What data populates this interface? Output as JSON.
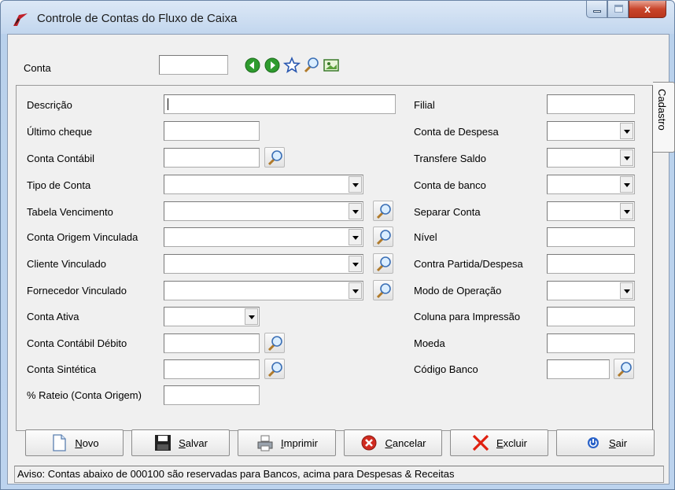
{
  "window": {
    "title": "Controle de Contas do Fluxo de Caixa",
    "close_glyph": "x"
  },
  "top": {
    "conta_label": "Conta",
    "conta_value": ""
  },
  "tab_label": "Cadastro",
  "left_fields": {
    "descricao": "Descrição",
    "ultimo_cheque": "Último cheque",
    "conta_contabil": "Conta Contábil",
    "tipo_conta": "Tipo de Conta",
    "tabela_vencimento": "Tabela Vencimento",
    "conta_origem": "Conta Origem Vinculada",
    "cliente": "Cliente Vinculado",
    "fornecedor": "Fornecedor Vinculado",
    "conta_ativa": "Conta Ativa",
    "contabil_debito": "Conta Contábil Débito",
    "conta_sintetica": "Conta Sintética",
    "rateio": "% Rateio (Conta Origem)"
  },
  "right_fields": {
    "filial": "Filial",
    "conta_despesa": "Conta de Despesa",
    "transfere_saldo": "Transfere Saldo",
    "conta_banco": "Conta de banco",
    "separar_conta": "Separar Conta",
    "nivel": "Nível",
    "contra_partida": "Contra Partida/Despesa",
    "modo_operacao": "Modo de Operação",
    "coluna_impressao": "Coluna para Impressão",
    "moeda": "Moeda",
    "codigo_banco": "Código Banco"
  },
  "buttons": {
    "novo": {
      "key": "N",
      "rest": "ovo"
    },
    "salvar": {
      "key": "S",
      "rest": "alvar"
    },
    "imprimir": {
      "key": "I",
      "rest": "mprimir"
    },
    "cancelar": {
      "key": "C",
      "rest": "ancelar"
    },
    "excluir": {
      "key": "E",
      "rest": "xcluir"
    },
    "sair": {
      "key": "S",
      "rest": "air"
    }
  },
  "status": "Aviso: Contas abaixo de 000100 são reservadas para Bancos, acima para Despesas & Receitas",
  "icons": {
    "app": "app-logo-icon",
    "prev": "previous-record-icon",
    "next": "next-record-icon",
    "favorite": "star-icon",
    "search": "magnifier-icon",
    "image": "picture-icon"
  },
  "colors": {
    "window_frame": "#b9d1ec",
    "close_button": "#c9452b",
    "nav_green": "#2e9b2e"
  }
}
